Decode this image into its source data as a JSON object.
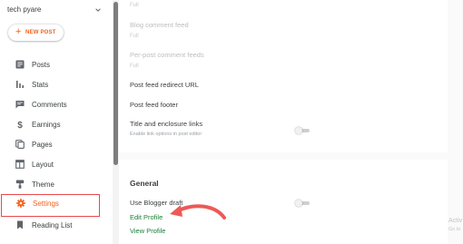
{
  "sidebar": {
    "blog_name": "tech pyare",
    "new_post_label": "NEW POST",
    "items": [
      {
        "label": "Posts",
        "icon": "posts-icon"
      },
      {
        "label": "Stats",
        "icon": "stats-icon"
      },
      {
        "label": "Comments",
        "icon": "comments-icon"
      },
      {
        "label": "Earnings",
        "icon": "dollar-icon"
      },
      {
        "label": "Pages",
        "icon": "pages-icon"
      },
      {
        "label": "Layout",
        "icon": "layout-icon"
      },
      {
        "label": "Theme",
        "icon": "theme-icon"
      },
      {
        "label": "Settings",
        "icon": "gear-icon",
        "active": true
      },
      {
        "label": "Reading List",
        "icon": "bookmark-icon"
      }
    ]
  },
  "main": {
    "feed": {
      "post_feed_value": "Full",
      "blog_comment_feed_label": "Blog comment feed",
      "blog_comment_feed_value": "Full",
      "per_post_comment_feeds_label": "Per-post comment feeds",
      "per_post_comment_feeds_value": "Full",
      "post_feed_redirect_url_label": "Post feed redirect URL",
      "post_feed_footer_label": "Post feed footer",
      "title_enclosure_links_label": "Title and enclosure links",
      "title_enclosure_links_hint": "Enable link options in post editor"
    },
    "general": {
      "title": "General",
      "use_blogger_draft_label": "Use Blogger draft",
      "edit_profile_label": "Edit Profile",
      "view_profile_label": "View Profile"
    }
  },
  "watermark": {
    "line1": "Activ",
    "line2": "Go to"
  },
  "colors": {
    "accent": "#f4611a",
    "highlight_border": "#e8484b",
    "link": "#188038",
    "annotation_arrow": "#ec5a56"
  }
}
